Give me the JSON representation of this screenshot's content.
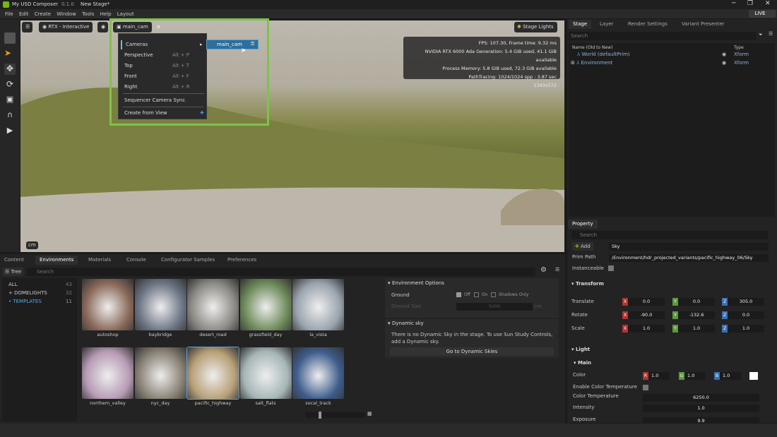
{
  "window": {
    "title": "My USD Composer",
    "version": "0.1.0",
    "doc": "New Stage*",
    "live_label": "LIVE"
  },
  "menu": [
    "File",
    "Edit",
    "Create",
    "Window",
    "Tools",
    "Help",
    "Layout"
  ],
  "viewport": {
    "render_mode": "RTX - Interactive",
    "camera": "main_cam",
    "stage_lights": "Stage Lights",
    "unit": "cm",
    "stats": [
      "FPS: 107.30, Frame time: 9.32 ms",
      "NVIDIA RTX 6000 Ada Generation: 5.4 GiB used, 41.1 GiB available",
      "Process Memory: 5.8 GiB used, 72.3 GiB available",
      "PathTracing: 1024/1024 spp : 3.87 sec",
      "1343x572"
    ],
    "camera_menu": {
      "cameras": "Cameras",
      "items": [
        {
          "label": "Perspective",
          "shortcut": "Alt + P"
        },
        {
          "label": "Top",
          "shortcut": "Alt + T"
        },
        {
          "label": "Front",
          "shortcut": "Alt + F"
        },
        {
          "label": "Right",
          "shortcut": "Alt + R"
        }
      ],
      "sync": "Sequencer Camera Sync",
      "create": "Create from View",
      "sub_item": "main_cam"
    }
  },
  "stage": {
    "tabs": [
      "Stage",
      "Layer",
      "Render Settings",
      "Variant Presenter"
    ],
    "search_placeholder": "Search",
    "col_name": "Name (Old to New)",
    "col_type": "Type",
    "rows": [
      {
        "name": "World (defaultPrim)",
        "type": "Xform"
      },
      {
        "name": "Environment",
        "type": "Xform"
      }
    ]
  },
  "property": {
    "tab": "Property",
    "search_placeholder": "Search",
    "add_label": "Add",
    "prim_name": "Sky",
    "prim_path_label": "Prim Path",
    "prim_path": "/Environment/hdr_projected_variants/pacific_highway_06/Sky",
    "instanceable_label": "Instanceable",
    "transform_label": "Transform",
    "translate": {
      "label": "Translate",
      "x": "0.0",
      "y": "0.0",
      "z": "305.0"
    },
    "rotate": {
      "label": "Rotate",
      "x": "-90.0",
      "y": "-132.6",
      "z": "0.0"
    },
    "scale": {
      "label": "Scale",
      "x": "1.0",
      "y": "1.0",
      "z": "1.0"
    },
    "light_label": "Light",
    "main_label": "Main",
    "color": {
      "label": "Color",
      "r": "1.0",
      "g": "1.0",
      "b": "1.0"
    },
    "enable_temp_label": "Enable Color Temperature",
    "temp": {
      "label": "Color Temperature",
      "value": "6250.0"
    },
    "intensity": {
      "label": "Intensity",
      "value": "1.0"
    },
    "exposure": {
      "label": "Exposure",
      "value": "9.9"
    }
  },
  "bottom": {
    "tabs": [
      "Content",
      "Environments",
      "Materials",
      "Console",
      "Configurator Samples",
      "Preferences"
    ],
    "tree_label": "Tree",
    "search_placeholder": "Search",
    "tree": [
      {
        "label": "ALL",
        "count": "43"
      },
      {
        "label": "DOMELIGHTS",
        "count": "32"
      },
      {
        "label": "TEMPLATES",
        "count": "11"
      }
    ],
    "thumbs": [
      {
        "label": "autoshop",
        "color": "#8a6a5a"
      },
      {
        "label": "baybridge",
        "color": "#6d7585"
      },
      {
        "label": "desert_road",
        "color": "#8c8a85"
      },
      {
        "label": "grassfield_day",
        "color": "#6e8a5a"
      },
      {
        "label": "la_vista",
        "color": "#9aa4ae"
      },
      {
        "label": "northern_valley",
        "color": "#b79bb5"
      },
      {
        "label": "nyc_day",
        "color": "#8a8275"
      },
      {
        "label": "pacific_highway",
        "color": "#b8a077"
      },
      {
        "label": "salt_flats",
        "color": "#a7b6b8"
      },
      {
        "label": "socal_track",
        "color": "#3e5d8c"
      }
    ],
    "env_options": {
      "title": "Environment Options",
      "ground": "Ground",
      "off": "Off",
      "on": "On",
      "shadows": "Shadows Only",
      "ground_size_label": "Ground Size",
      "ground_size": "5000",
      "unit": "cm"
    },
    "dynamic_sky": {
      "title": "Dynamic sky",
      "text": "There is no Dynamic Sky in the stage. To use Sun Study Controls, add a Dynamic sky.",
      "button": "Go to Dynamic Skies"
    }
  },
  "colors": {
    "accent_green": "#7ec34b",
    "selection_blue": "#2c6e9c",
    "axis_x": "#b3332f",
    "axis_y": "#5a9a3a",
    "axis_z": "#3a6fb3"
  }
}
